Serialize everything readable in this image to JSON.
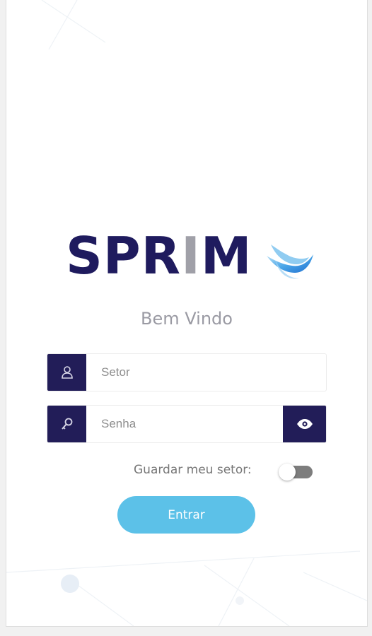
{
  "brand": {
    "name_prefix": "SPR",
    "name_mid": "I",
    "name_suffix": "M"
  },
  "welcome": "Bem Vindo",
  "form": {
    "setor": {
      "placeholder": "Setor",
      "value": "",
      "icon": "user-icon"
    },
    "senha": {
      "placeholder": "Senha",
      "value": "",
      "icon": "key-icon",
      "toggle_icon": "eye-icon"
    },
    "remember": {
      "label": "Guardar meu setor:",
      "checked": false
    },
    "submit_label": "Entrar"
  },
  "colors": {
    "brand_navy": "#221d58",
    "button_blue": "#5cc1e8",
    "logo_accent": "#2f8ee0"
  }
}
